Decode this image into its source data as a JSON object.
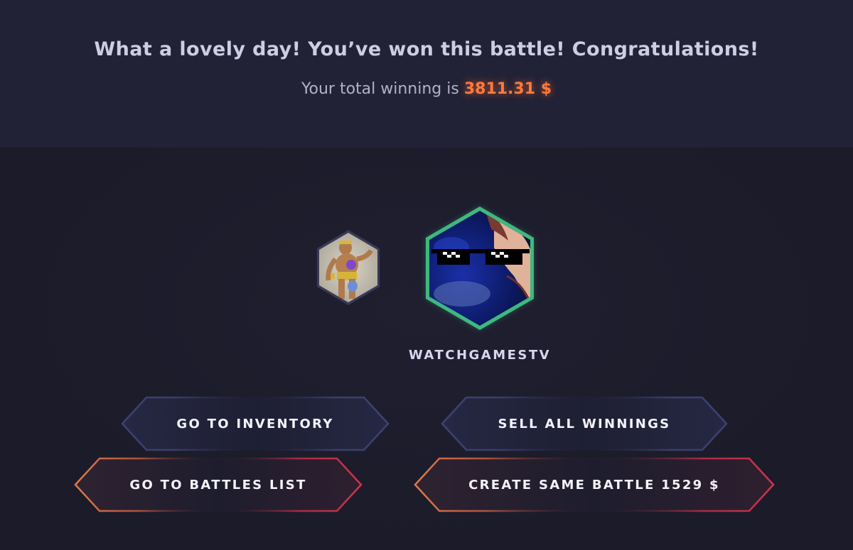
{
  "result": {
    "headline": "What a lovely day! You’ve won this battle! Congratulations!",
    "winning_prefix": "Your total winning is",
    "winning_amount": "3811.31 $"
  },
  "players": {
    "loser": {
      "avatar_icon": "wrestler-figure-avatar"
    },
    "winner": {
      "avatar_icon": "pixel-sunglasses-avatar",
      "name": "WATCHGAMESTV",
      "border_color": "#3fb87f"
    }
  },
  "actions": {
    "go_to_inventory": "GO TO INVENTORY",
    "sell_all_winnings": "SELL ALL WINNINGS",
    "go_to_battles_list": "GO TO BATTLES LIST",
    "create_same_battle": "CREATE SAME BATTLE 1529 $"
  },
  "colors": {
    "accent_orange": "#ff7a3d",
    "button_blue_border": "#3b3f66",
    "button_warm_left": "#e07a4a",
    "button_warm_right": "#d2344a"
  }
}
